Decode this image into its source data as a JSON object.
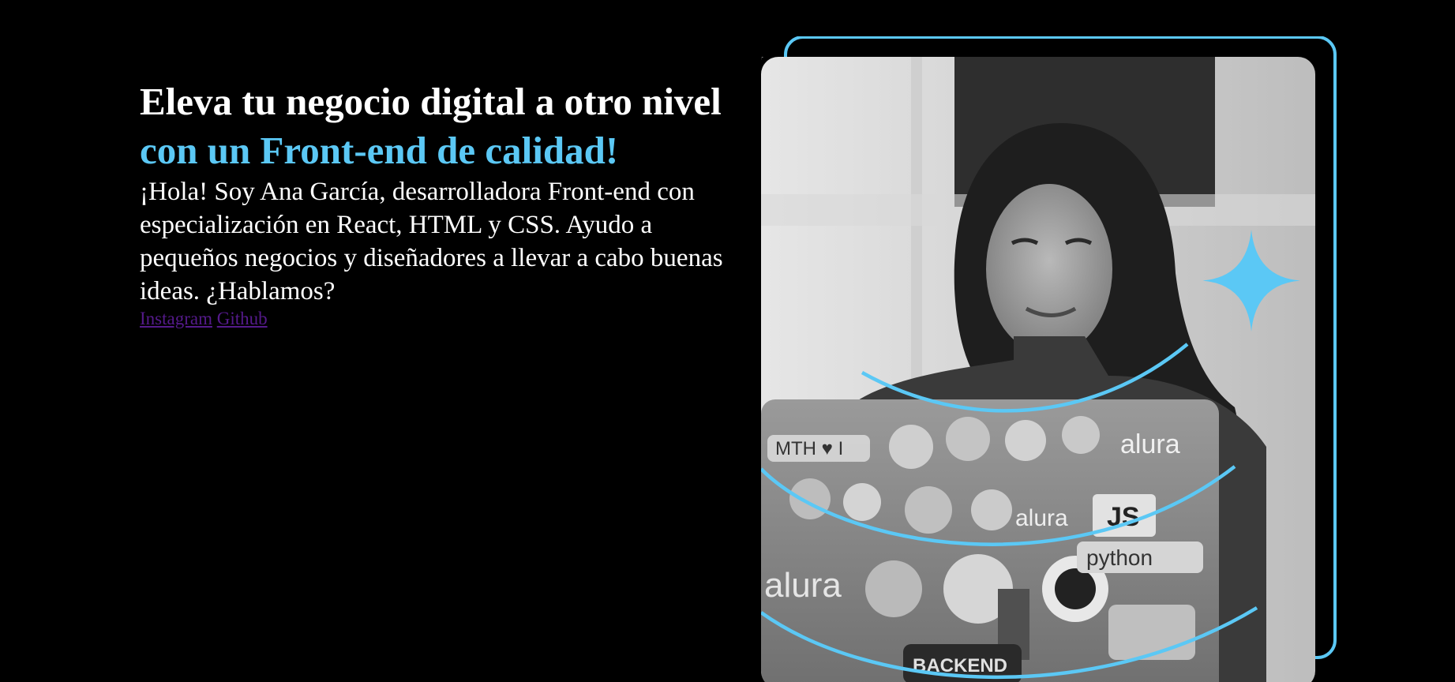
{
  "hero": {
    "title_part1": "Eleva tu negocio digital a otro nivel ",
    "title_accent": "con un Front-end de calidad!",
    "description": "¡Hola! Soy Ana García, desarrolladora Front-end con especialización en React, HTML y CSS. Ayudo a pequeños negocios y diseñadores a llevar a cabo buenas ideas. ¿Hablamos?"
  },
  "social": {
    "instagram_label": "Instagram",
    "github_label": "Github"
  },
  "laptop_stickers": {
    "text_1": "alura",
    "text_2": "JS",
    "text_3": "alura",
    "text_4": "python",
    "text_5": "alura",
    "text_6": "MTH ♥ I",
    "text_7": "BACKEND"
  },
  "colors": {
    "background": "#000000",
    "accent": "#5bc8f5",
    "text": "#ffffff",
    "link": "#551a8b"
  }
}
